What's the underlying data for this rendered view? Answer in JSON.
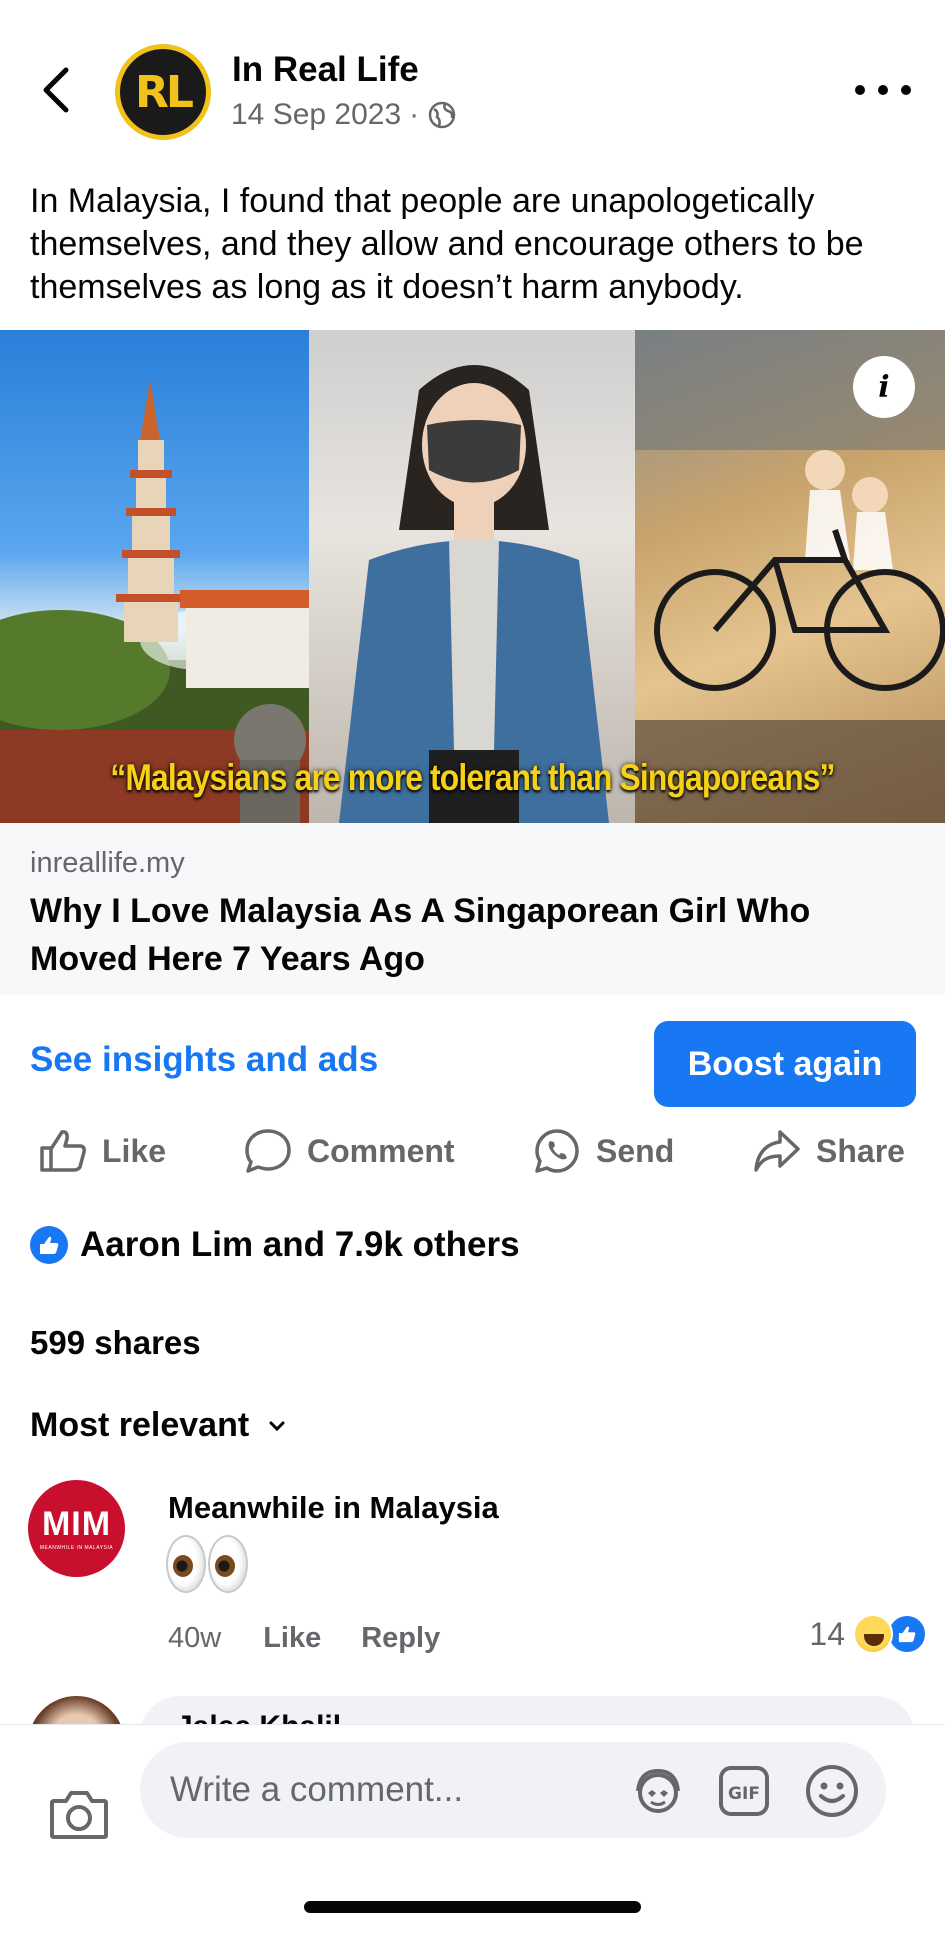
{
  "header": {
    "page_name": "In Real Life",
    "avatar_text": "RL",
    "date": "14 Sep 2023",
    "separator": "·",
    "audience_icon": "globe-icon"
  },
  "post": {
    "text": "In Malaysia, I found that people are unapologetically themselves, and they allow and encourage others to be themselves as long as it doesn’t harm anybody."
  },
  "link_preview": {
    "image_caption": "“Malaysians are more tolerant than Singaporeans”",
    "info_label": "i",
    "domain": "inreallife.my",
    "title": "Why I Love Malaysia As A Singaporean Girl Who Moved Here 7 Years Ago"
  },
  "insights": {
    "link_label": "See insights and ads",
    "boost_label": "Boost again"
  },
  "actions": [
    {
      "label": "Like",
      "icon": "thumbs-up-icon"
    },
    {
      "label": "Comment",
      "icon": "comment-bubble-icon"
    },
    {
      "label": "Send",
      "icon": "whatsapp-icon"
    },
    {
      "label": "Share",
      "icon": "share-arrow-icon"
    }
  ],
  "reactions": {
    "summary": "Aaron Lim and 7.9k others",
    "shares": "599 shares"
  },
  "comments_sort": {
    "selected": "Most relevant"
  },
  "comments": [
    {
      "author": "Meanwhile in Malaysia",
      "avatar_text": "MIM",
      "avatar_subtext": "MEANWHILE IN MALAYSIA",
      "body_emoji": "eyes",
      "time": "40w",
      "like_label": "Like",
      "reply_label": "Reply",
      "reaction_count": "14",
      "reaction_icons": [
        "haha-icon",
        "like-icon"
      ]
    },
    {
      "author": "Jalee Khalil"
    }
  ],
  "composer": {
    "placeholder": "Write a comment..."
  },
  "colors": {
    "accent": "#1877f2",
    "secondary_text": "#65676b",
    "primary_text": "#050505",
    "caption_yellow": "#f6d117",
    "brand_rl_yellow": "#f1c21b",
    "mim_red": "#c8102e"
  }
}
